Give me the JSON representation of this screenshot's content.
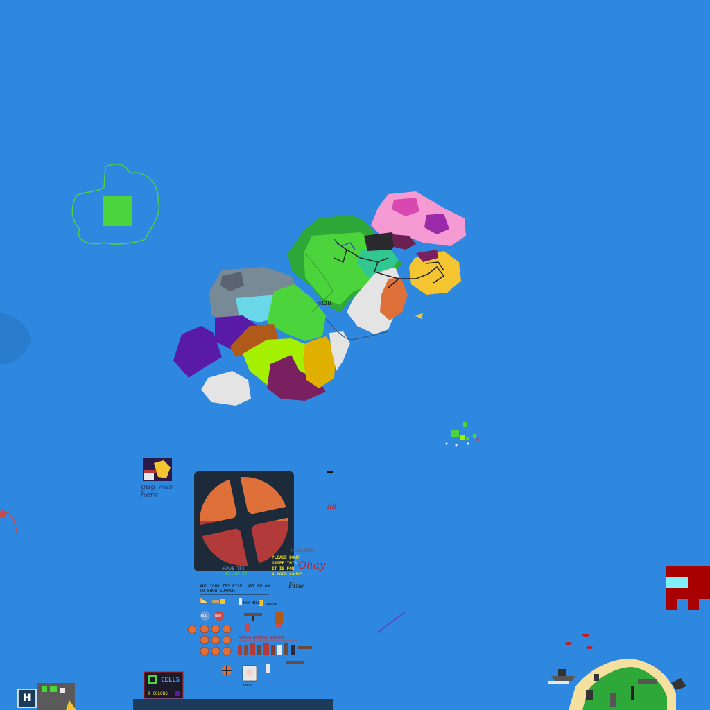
{
  "canvas": {
    "background": "#2e88e0"
  },
  "labels": {
    "island_tag": "Hi2N",
    "sign_line1": "gug was",
    "sign_line2": "here",
    "dit": "dit",
    "save_tf2": "#SAVE TF2",
    "date": "26 JAN 22",
    "credit": "MINEERR251",
    "please_line1": "PLEASE DONT",
    "please_line2": "GRIEF THIS",
    "please_line3": "IT IS FOR",
    "please_line4": "A GOOD CAUSE",
    "ohay": "Ohay",
    "fine": "Fine",
    "add_line1": "ADD YOUR TF2 PIXEL ART BELOW",
    "add_line2": "TO SHOW SUPPORT",
    "milk": "MAD MILK",
    "jarate": "JARATE",
    "blu": "BLU",
    "red": "RED",
    "classes": "ATTACK   DEFENSE   SUPPORT",
    "uber": "UBER",
    "cells": "CELLS",
    "colors": "9 COLORS",
    "h_badge": "H"
  },
  "colors": {
    "tf2_orange": "#e0703a",
    "tf2_red": "#b33a3a",
    "tf2_dark": "#1c2a3a",
    "island_green": "#4cd43c",
    "pink": "#f59ad2",
    "yellow": "#f5c431",
    "purple": "#5a1aa8",
    "lime": "#a5ef00",
    "maroon": "#7a2060",
    "grey": "#788a96",
    "white_zone": "#e4e4e4"
  },
  "icons": [
    "tf2-logo-icon",
    "h-badge-icon",
    "cells-icon",
    "ship-icon"
  ]
}
